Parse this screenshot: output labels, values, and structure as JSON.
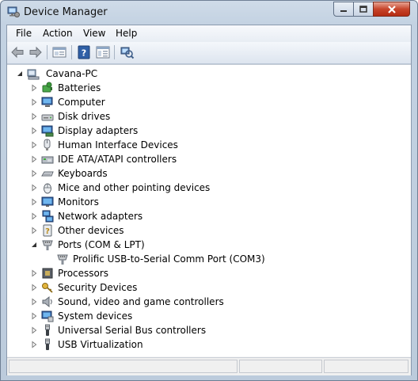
{
  "window": {
    "title": "Device Manager"
  },
  "menu": [
    "File",
    "Action",
    "View",
    "Help"
  ],
  "toolbar": [
    "back-icon",
    "forward-icon",
    "properties-pane-icon",
    "help-icon",
    "show-hide-console-tree-icon",
    "scan-hardware-icon"
  ],
  "tree": {
    "root": "Cavana-PC",
    "categories": [
      {
        "label": "Batteries",
        "icon": "battery-icon",
        "expanded": false
      },
      {
        "label": "Computer",
        "icon": "computer-icon",
        "expanded": false
      },
      {
        "label": "Disk drives",
        "icon": "disk-drive-icon",
        "expanded": false
      },
      {
        "label": "Display adapters",
        "icon": "display-adapter-icon",
        "expanded": false
      },
      {
        "label": "Human Interface Devices",
        "icon": "hid-icon",
        "expanded": false
      },
      {
        "label": "IDE ATA/ATAPI controllers",
        "icon": "ide-controller-icon",
        "expanded": false
      },
      {
        "label": "Keyboards",
        "icon": "keyboard-icon",
        "expanded": false
      },
      {
        "label": "Mice and other pointing devices",
        "icon": "mouse-icon",
        "expanded": false
      },
      {
        "label": "Monitors",
        "icon": "monitor-icon",
        "expanded": false
      },
      {
        "label": "Network adapters",
        "icon": "network-adapter-icon",
        "expanded": false
      },
      {
        "label": "Other devices",
        "icon": "other-device-icon",
        "expanded": false
      },
      {
        "label": "Ports (COM & LPT)",
        "icon": "port-icon",
        "expanded": true,
        "children": [
          {
            "label": "Prolific USB-to-Serial Comm Port (COM3)",
            "icon": "port-icon"
          }
        ]
      },
      {
        "label": "Processors",
        "icon": "processor-icon",
        "expanded": false
      },
      {
        "label": "Security Devices",
        "icon": "security-key-icon",
        "expanded": false
      },
      {
        "label": "Sound, video and game controllers",
        "icon": "speaker-icon",
        "expanded": false
      },
      {
        "label": "System devices",
        "icon": "system-device-icon",
        "expanded": false
      },
      {
        "label": "Universal Serial Bus controllers",
        "icon": "usb-icon",
        "expanded": false
      },
      {
        "label": "USB Virtualization",
        "icon": "usb-icon",
        "expanded": false
      }
    ]
  }
}
